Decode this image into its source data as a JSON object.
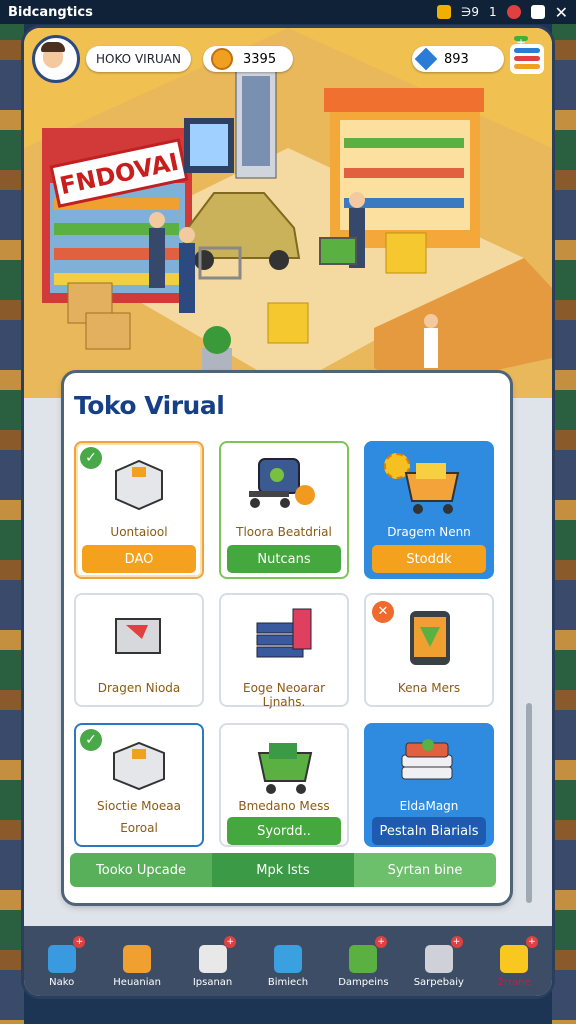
{
  "status_bar": {
    "app_title": "Bidcangtics",
    "indicator_1": "∋9",
    "indicator_2": "1"
  },
  "header": {
    "player_name": "HOKO VIRUAN",
    "coins": "3395",
    "gems": "893",
    "menu_plus": "+"
  },
  "scene": {
    "store_sign": "FNDOVAI"
  },
  "card": {
    "title": "Toko Virual",
    "tiles": [
      {
        "label": "Uontaiool",
        "button": "DAO",
        "check": "✓"
      },
      {
        "label": "Tloora Beatdrial",
        "button": "Nutcans"
      },
      {
        "label": "Dragem Nenn",
        "button": "Stoddk"
      },
      {
        "label": "Dragen Nioda"
      },
      {
        "label": "Eoge Neoarar Ljnahs."
      },
      {
        "label": "Kena Mers",
        "badge": "✕"
      },
      {
        "label_line1": "Sioctie Moeaa",
        "label_line2": "Eoroal",
        "check": "✓"
      },
      {
        "label": "Bmedano Mess",
        "button": "Syordd.."
      },
      {
        "label": "EldaMagn",
        "button": "Pestaln Biarials"
      }
    ],
    "tabs": [
      "Tooko Upcade",
      "Mpk  lsts",
      "Syrtan bine"
    ]
  },
  "nav": [
    {
      "label": "Nako",
      "badge": "+",
      "color": "#3a9ae0"
    },
    {
      "label": "Heuanian",
      "color": "#f0a030"
    },
    {
      "label": "Ipsanan",
      "badge": "+",
      "color": "#e8e8e8"
    },
    {
      "label": "Bimiech",
      "color": "#3aa0e0"
    },
    {
      "label": "Dampeins",
      "badge": "+",
      "color": "#5ab040"
    },
    {
      "label": "Sarpebaiy",
      "badge": "+",
      "color": "#d0d0d8"
    },
    {
      "label": "2rrane",
      "badge": "+",
      "color": "#e04080"
    }
  ]
}
